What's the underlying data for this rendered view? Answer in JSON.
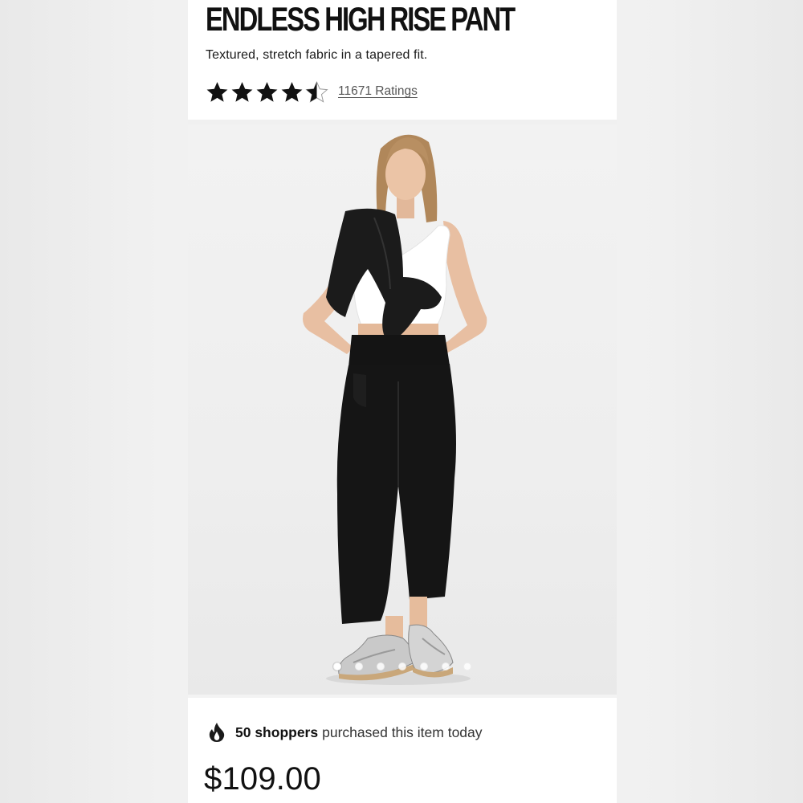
{
  "product": {
    "title": "ENDLESS HIGH RISE PANT",
    "description": "Textured, stretch fabric in a tapered fit.",
    "rating_value": 4.5,
    "rating_max": 5,
    "ratings_link": "11671 Ratings"
  },
  "gallery": {
    "image_alt": "Model wearing black high rise pants with white crop top and silver sneakers",
    "slide_count": 7,
    "active_slide": 1
  },
  "social_proof": {
    "icon": "flame-icon",
    "count_text": "50 shoppers",
    "rest_text": "purchased this item today"
  },
  "price": "$109.00",
  "colors": {
    "text": "#111111",
    "muted": "#555555",
    "background": "#ffffff"
  }
}
